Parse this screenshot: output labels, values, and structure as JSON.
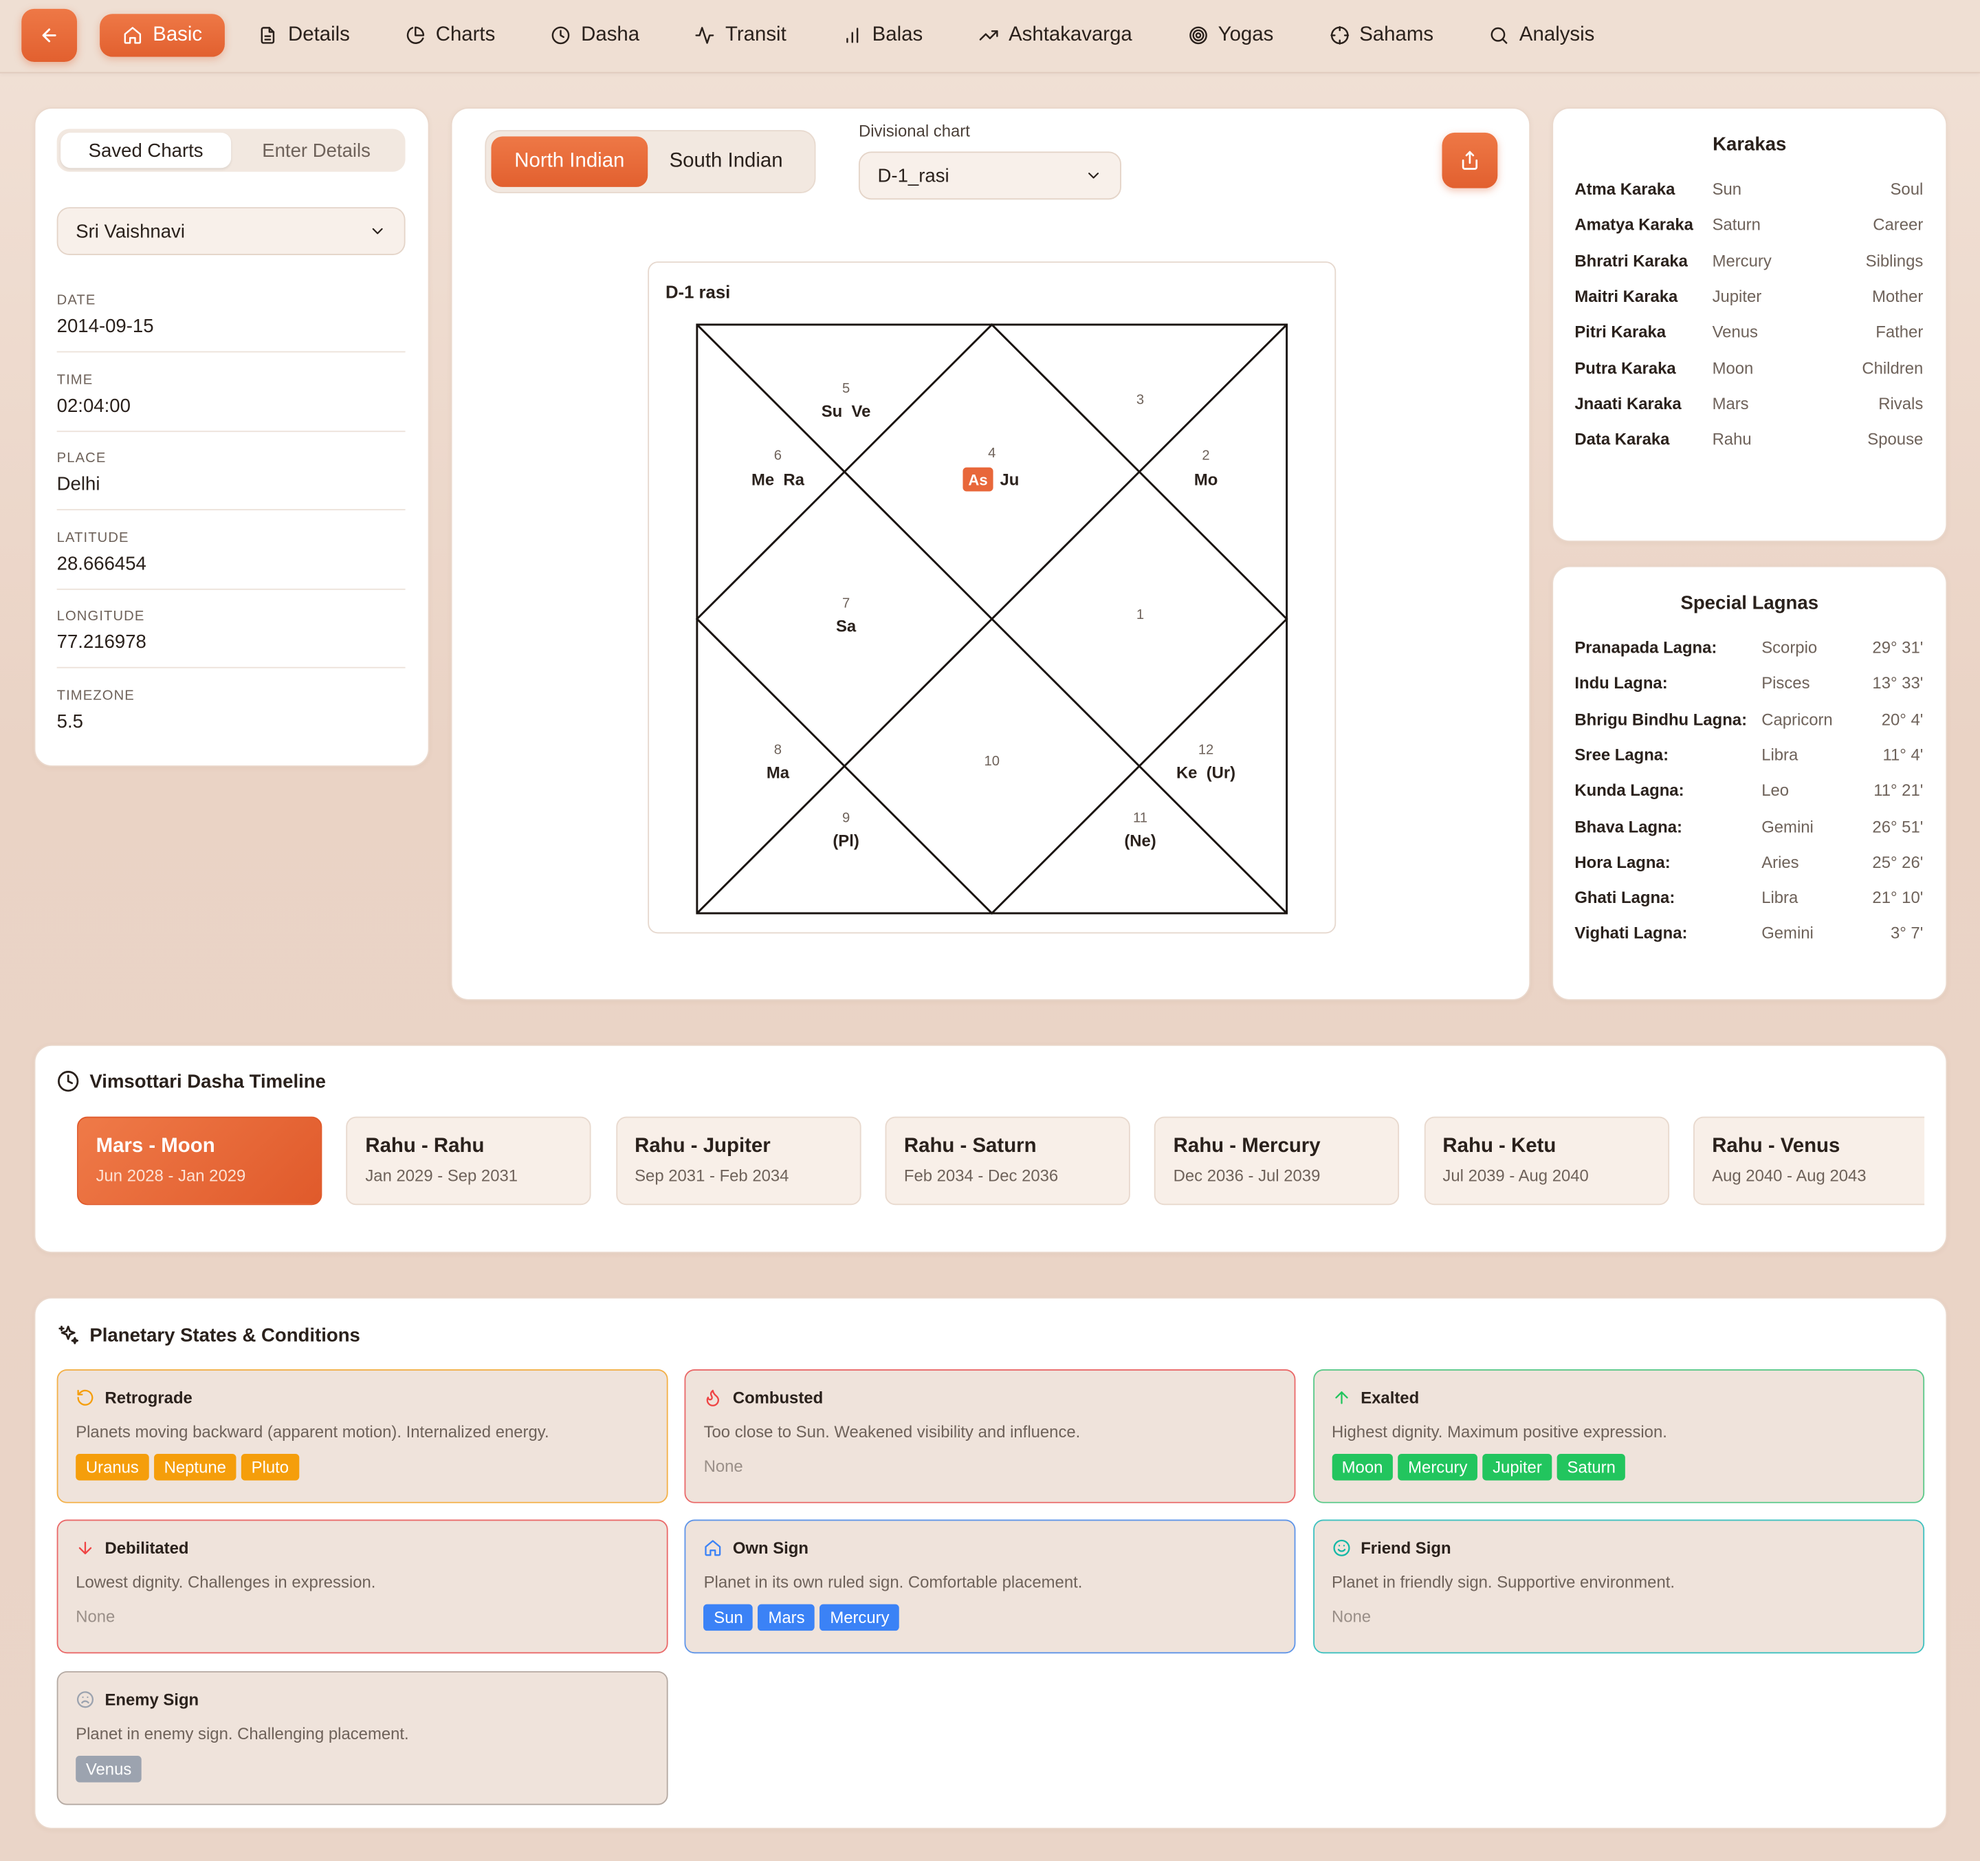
{
  "nav": {
    "tabs": [
      {
        "label": "Basic",
        "icon": "home-icon"
      },
      {
        "label": "Details",
        "icon": "document-icon"
      },
      {
        "label": "Charts",
        "icon": "pie-chart-icon"
      },
      {
        "label": "Dasha",
        "icon": "clock-icon"
      },
      {
        "label": "Transit",
        "icon": "activity-icon"
      },
      {
        "label": "Balas",
        "icon": "bar-chart-icon"
      },
      {
        "label": "Ashtakavarga",
        "icon": "trending-up-icon"
      },
      {
        "label": "Yogas",
        "icon": "target-icon"
      },
      {
        "label": "Sahams",
        "icon": "crosshair-icon"
      },
      {
        "label": "Analysis",
        "icon": "search-icon"
      }
    ]
  },
  "left": {
    "seg": [
      "Saved Charts",
      "Enter Details"
    ],
    "selected_chart": "Sri Vaishnavi",
    "fields": [
      {
        "label": "Date",
        "value": "2014-09-15"
      },
      {
        "label": "Time",
        "value": "02:04:00"
      },
      {
        "label": "Place",
        "value": "Delhi"
      },
      {
        "label": "Latitude",
        "value": "28.666454"
      },
      {
        "label": "Longitude",
        "value": "77.216978"
      },
      {
        "label": "Timezone",
        "value": "5.5"
      }
    ]
  },
  "center": {
    "style_tabs": [
      "North Indian",
      "South Indian"
    ],
    "divisional_label": "Divisional chart",
    "divisional_value": "D-1_rasi",
    "chart_title": "D-1 rasi",
    "houses": [
      {
        "num": "5",
        "planets": "Su  Ve"
      },
      {
        "num": "3",
        "planets": ""
      },
      {
        "num": "6",
        "planets": "Me  Ra"
      },
      {
        "num": "4",
        "planets": "Ju",
        "asc": "As"
      },
      {
        "num": "2",
        "planets": "Mo"
      },
      {
        "num": "7",
        "planets": "Sa"
      },
      {
        "num": "1",
        "planets": ""
      },
      {
        "num": "8",
        "planets": "Ma"
      },
      {
        "num": "10",
        "planets": ""
      },
      {
        "num": "12",
        "planets": "Ke  (Ur)"
      },
      {
        "num": "9",
        "planets": "(Pl)"
      },
      {
        "num": "11",
        "planets": "(Ne)"
      }
    ]
  },
  "karakas": {
    "title": "Karakas",
    "rows": [
      [
        "Atma Karaka",
        "Sun",
        "Soul"
      ],
      [
        "Amatya Karaka",
        "Saturn",
        "Career"
      ],
      [
        "Bhratri Karaka",
        "Mercury",
        "Siblings"
      ],
      [
        "Maitri Karaka",
        "Jupiter",
        "Mother"
      ],
      [
        "Pitri Karaka",
        "Venus",
        "Father"
      ],
      [
        "Putra Karaka",
        "Moon",
        "Children"
      ],
      [
        "Jnaati Karaka",
        "Mars",
        "Rivals"
      ],
      [
        "Data Karaka",
        "Rahu",
        "Spouse"
      ]
    ]
  },
  "lagnas": {
    "title": "Special Lagnas",
    "rows": [
      [
        "Pranapada Lagna:",
        "Scorpio",
        "29° 31'"
      ],
      [
        "Indu Lagna:",
        "Pisces",
        "13° 33'"
      ],
      [
        "Bhrigu Bindhu Lagna:",
        "Capricorn",
        "20° 4'"
      ],
      [
        "Sree Lagna:",
        "Libra",
        "11° 4'"
      ],
      [
        "Kunda Lagna:",
        "Leo",
        "11° 21'"
      ],
      [
        "Bhava Lagna:",
        "Gemini",
        "26° 51'"
      ],
      [
        "Hora Lagna:",
        "Aries",
        "25° 26'"
      ],
      [
        "Ghati Lagna:",
        "Libra",
        "21° 10'"
      ],
      [
        "Vighati Lagna:",
        "Gemini",
        "3° 7'"
      ]
    ]
  },
  "dasha": {
    "title": "Vimsottari Dasha Timeline",
    "items": [
      {
        "title": "Mars - Moon",
        "dates": "Jun 2028 - Jan 2029"
      },
      {
        "title": "Rahu - Rahu",
        "dates": "Jan 2029 - Sep 2031"
      },
      {
        "title": "Rahu - Jupiter",
        "dates": "Sep 2031 - Feb 2034"
      },
      {
        "title": "Rahu - Saturn",
        "dates": "Feb 2034 - Dec 2036"
      },
      {
        "title": "Rahu - Mercury",
        "dates": "Dec 2036 - Jul 2039"
      },
      {
        "title": "Rahu - Ketu",
        "dates": "Jul 2039 - Aug 2040"
      },
      {
        "title": "Rahu - Venus",
        "dates": "Aug 2040 - Aug 2043"
      }
    ]
  },
  "states": {
    "title": "Planetary States & Conditions",
    "none_label": "None",
    "boxes": [
      {
        "title": "Retrograde",
        "desc": "Planets moving backward (apparent motion). Internalized energy.",
        "chips": [
          "Uranus",
          "Neptune",
          "Pluto"
        ],
        "color": "#f59e0b",
        "border": "#f3b14a",
        "icon": "rotate-ccw-icon"
      },
      {
        "title": "Combusted",
        "desc": "Too close to Sun. Weakened visibility and influence.",
        "chips": [],
        "color": "#ef4444",
        "border": "#ea6a6a",
        "icon": "flame-icon"
      },
      {
        "title": "Exalted",
        "desc": "Highest dignity. Maximum positive expression.",
        "chips": [
          "Moon",
          "Mercury",
          "Jupiter",
          "Saturn"
        ],
        "color": "#22c55e",
        "border": "#5cc98a",
        "icon": "arrow-up-icon"
      },
      {
        "title": "Debilitated",
        "desc": "Lowest dignity. Challenges in expression.",
        "chips": [],
        "color": "#ef4444",
        "border": "#ea6a6a",
        "icon": "arrow-down-icon"
      },
      {
        "title": "Own Sign",
        "desc": "Planet in its own ruled sign. Comfortable placement.",
        "chips": [
          "Sun",
          "Mars",
          "Mercury"
        ],
        "color": "#3b82f6",
        "border": "#5f95e8",
        "icon": "home-icon"
      },
      {
        "title": "Friend Sign",
        "desc": "Planet in friendly sign. Supportive environment.",
        "chips": [],
        "color": "#14b8a6",
        "border": "#3fc1c0",
        "icon": "smile-icon"
      },
      {
        "title": "Enemy Sign",
        "desc": "Planet in enemy sign. Challenging placement.",
        "chips": [
          "Venus"
        ],
        "color": "#9ca3af",
        "border": "#b5aaa3",
        "icon": "frown-icon"
      }
    ]
  }
}
